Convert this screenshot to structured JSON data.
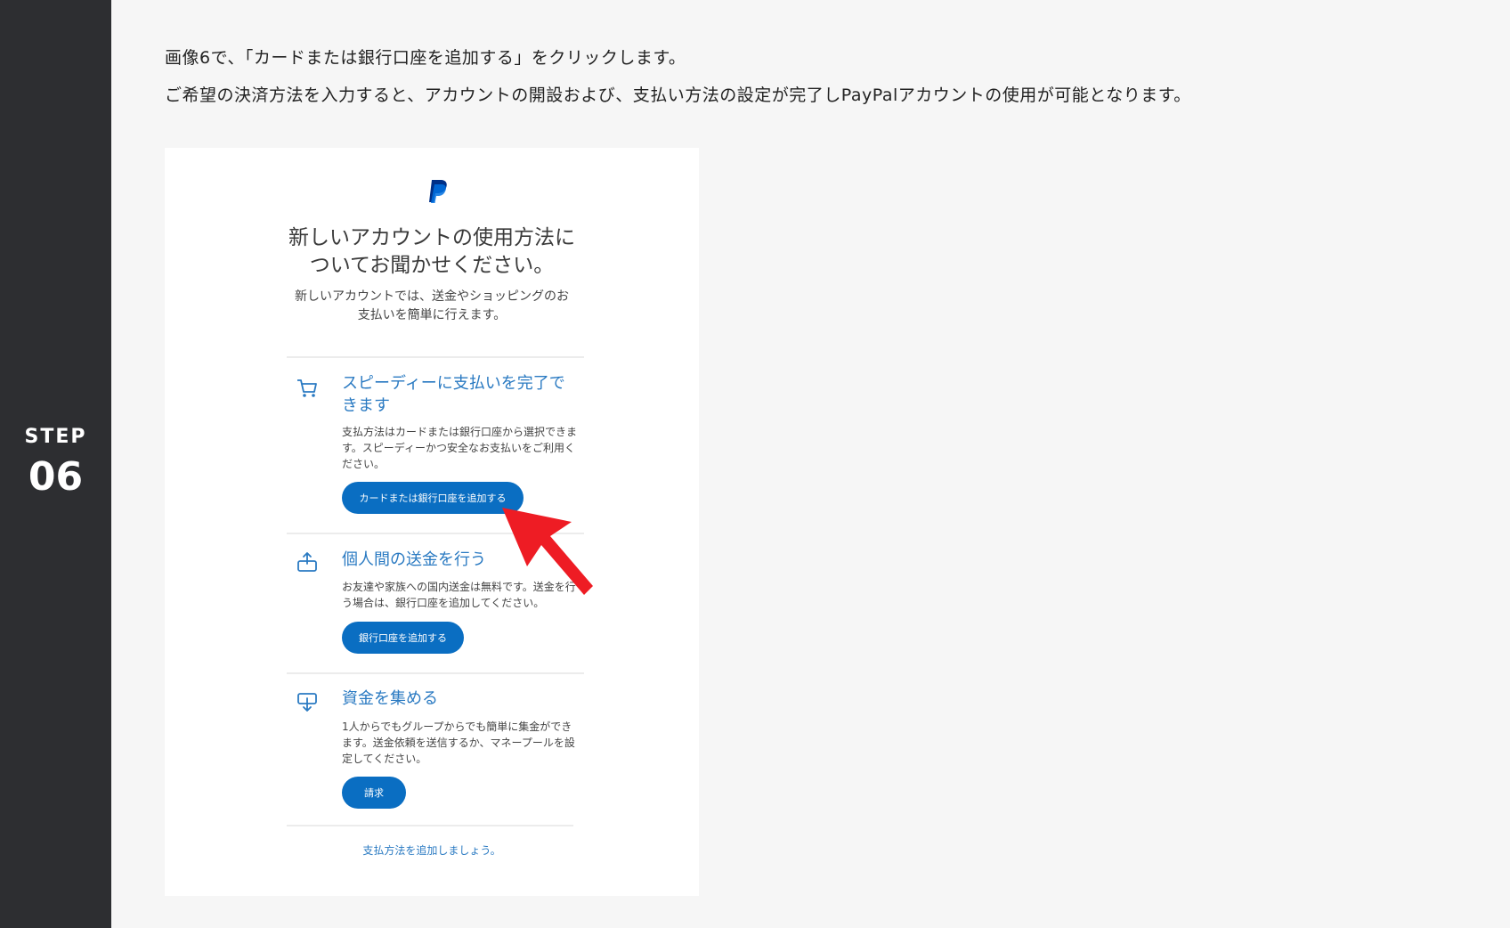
{
  "step": {
    "label": "STEP",
    "number": "06"
  },
  "intro": {
    "line1": "画像6で、「カードまたは銀行口座を追加する」をクリックします。",
    "line2": "ご希望の決済方法を入力すると、アカウントの開設および、支払い方法の設定が完了しPayPalアカウントの使用が可能となります。"
  },
  "screenshot": {
    "logo_icon": "paypal-logo",
    "headline_line1": "新しいアカウントの使用方法に",
    "headline_line2": "ついてお聞かせください。",
    "sub_line1": "新しいアカウントでは、送金やショッピングのお",
    "sub_line2": "支払いを簡単に行えます。",
    "features": [
      {
        "icon": "cart-icon",
        "title_line1": "スピーディーに支払いを完了で",
        "title_line2": "きます",
        "desc_line1": "支払方法はカードまたは銀行口座から選択できま",
        "desc_line2": "す。スピーディーかつ安全なお支払いをご利用く",
        "desc_line3": "ださい。",
        "button": "カードまたは銀行口座を追加する"
      },
      {
        "icon": "send-icon",
        "title_line1": "個人間の送金を行う",
        "desc_line1": "お友達や家族への国内送金は無料です。送金を行",
        "desc_line2": "う場合は、銀行口座を追加してください。",
        "button": "銀行口座を追加する"
      },
      {
        "icon": "receive-icon",
        "title_line1": "資金を集める",
        "desc_line1": "1人からでもグループからでも簡単に集金ができ",
        "desc_line2": "ます。送金依頼を送信するか、マネープールを設",
        "desc_line3": "定してください。",
        "button": "請求"
      }
    ],
    "footer_link": "支払方法を追加しましょう。"
  },
  "colors": {
    "sidebar": "#2d2e31",
    "accent_blue": "#0a6ec2",
    "title_blue": "#2a7ac2",
    "arrow_red": "#ee1c24"
  }
}
